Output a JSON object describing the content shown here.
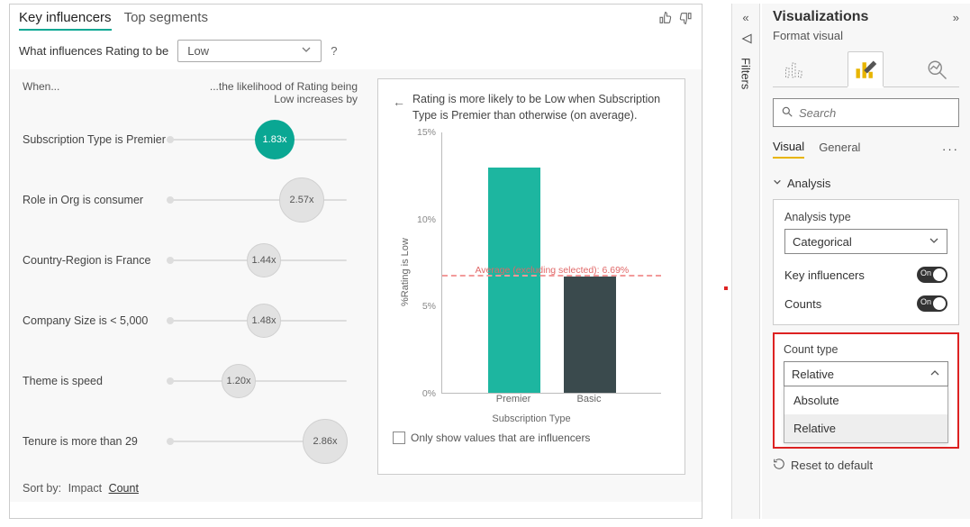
{
  "visual": {
    "tabs": [
      "Key influencers",
      "Top segments"
    ],
    "active_tab": 0,
    "thumbs_up": "👍",
    "thumbs_down": "👎",
    "question_prefix": "What influences Rating to be",
    "question_value": "Low",
    "question_mark": "?"
  },
  "left": {
    "header_when": "When...",
    "header_likelihood": "...the likelihood of Rating being Low increases by",
    "items": [
      {
        "label": "Subscription Type is Premier",
        "value": "1.83x",
        "pos": 60,
        "size": 44,
        "selected": true
      },
      {
        "label": "Role in Org is consumer",
        "value": "2.57x",
        "pos": 75,
        "size": 50,
        "selected": false
      },
      {
        "label": "Country-Region is France",
        "value": "1.44x",
        "pos": 54,
        "size": 38,
        "selected": false
      },
      {
        "label": "Company Size is < 5,000",
        "value": "1.48x",
        "pos": 54,
        "size": 38,
        "selected": false
      },
      {
        "label": "Theme is speed",
        "value": "1.20x",
        "pos": 40,
        "size": 38,
        "selected": false
      },
      {
        "label": "Tenure is more than 29",
        "value": "2.86x",
        "pos": 88,
        "size": 50,
        "selected": false
      }
    ],
    "sort_label": "Sort by:",
    "sort_options": [
      "Impact",
      "Count"
    ],
    "sort_active": "Count"
  },
  "chart": {
    "title": "Rating is more likely to be Low when Subscription Type is Premier than otherwise (on average).",
    "y_label": "%Rating is Low",
    "x_label": "Subscription Type",
    "y_ticks": [
      "0%",
      "5%",
      "10%",
      "15%"
    ],
    "y_max": 15,
    "avg_value": 6.69,
    "avg_label": "Average (excluding selected): 6.69%",
    "footer_checkbox": "Only show values that are influencers"
  },
  "chart_data": {
    "type": "bar",
    "categories": [
      "Premier",
      "Basic"
    ],
    "values": [
      13,
      6.69
    ],
    "colors": [
      "#1db6a0",
      "#3a4a4d"
    ],
    "ylabel": "%Rating is Low",
    "xlabel": "Subscription Type",
    "ylim": [
      0,
      15
    ],
    "reference_line": {
      "label": "Average (excluding selected)",
      "value": 6.69
    }
  },
  "filters": {
    "label": "Filters"
  },
  "viz": {
    "title": "Visualizations",
    "subtitle": "Format visual",
    "search_placeholder": "Search",
    "subtabs": [
      "Visual",
      "General"
    ],
    "subtab_active": "Visual",
    "section": "Analysis",
    "analysis_type_label": "Analysis type",
    "analysis_type_value": "Categorical",
    "ki_label": "Key influencers",
    "ki_on": "On",
    "counts_label": "Counts",
    "counts_on": "On",
    "count_type_label": "Count type",
    "count_type_value": "Relative",
    "count_type_options": [
      "Absolute",
      "Relative"
    ],
    "reset": "Reset to default"
  }
}
